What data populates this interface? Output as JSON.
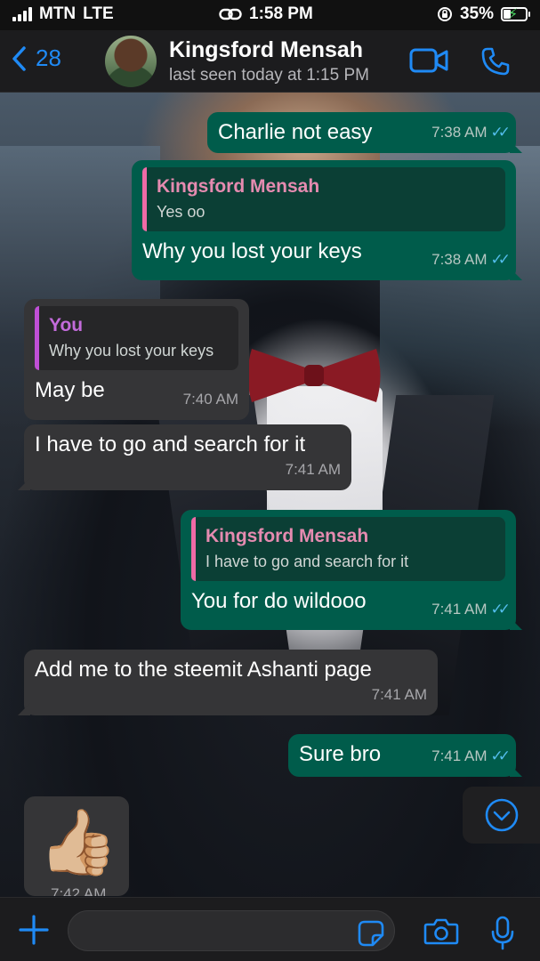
{
  "status_bar": {
    "carrier": "MTN",
    "network": "LTE",
    "time": "1:58 PM",
    "battery": "35%"
  },
  "header": {
    "back_count": "28",
    "contact_name": "Kingsford Mensah",
    "last_seen": "last seen today at 1:15 PM"
  },
  "messages": [
    {
      "direction": "out",
      "text": "Charlie not easy",
      "time": "7:38 AM"
    },
    {
      "direction": "out",
      "quote_name": "Kingsford Mensah",
      "quote_text": "Yes oo",
      "text": "Why you lost your keys",
      "time": "7:38 AM"
    },
    {
      "direction": "in",
      "quote_name": "You",
      "quote_text": "Why you lost your keys",
      "text": "May be",
      "time": "7:40 AM"
    },
    {
      "direction": "in",
      "text": "I have to go and search for it",
      "time": "7:41 AM"
    },
    {
      "direction": "out",
      "quote_name": "Kingsford Mensah",
      "quote_text": "I have to go and search for it",
      "text": "You for do wildooo",
      "time": "7:41 AM"
    },
    {
      "direction": "in",
      "text": "Add me to the steemit Ashanti page",
      "time": "7:41 AM"
    },
    {
      "direction": "out",
      "text": "Sure bro",
      "time": "7:41 AM"
    },
    {
      "direction": "in",
      "emoji": "👍🏼",
      "time": "7:42 AM"
    }
  ],
  "input": {
    "placeholder": ""
  },
  "colors": {
    "accent": "#1f8af5",
    "outgoing_bubble": "#005c4b",
    "incoming_bubble": "#353537",
    "read_ticks": "#53bdeb"
  },
  "icons": [
    "back-chevron-icon",
    "video-call-icon",
    "phone-icon",
    "scroll-down-icon",
    "plus-icon",
    "sticker-icon",
    "camera-icon",
    "microphone-icon"
  ]
}
